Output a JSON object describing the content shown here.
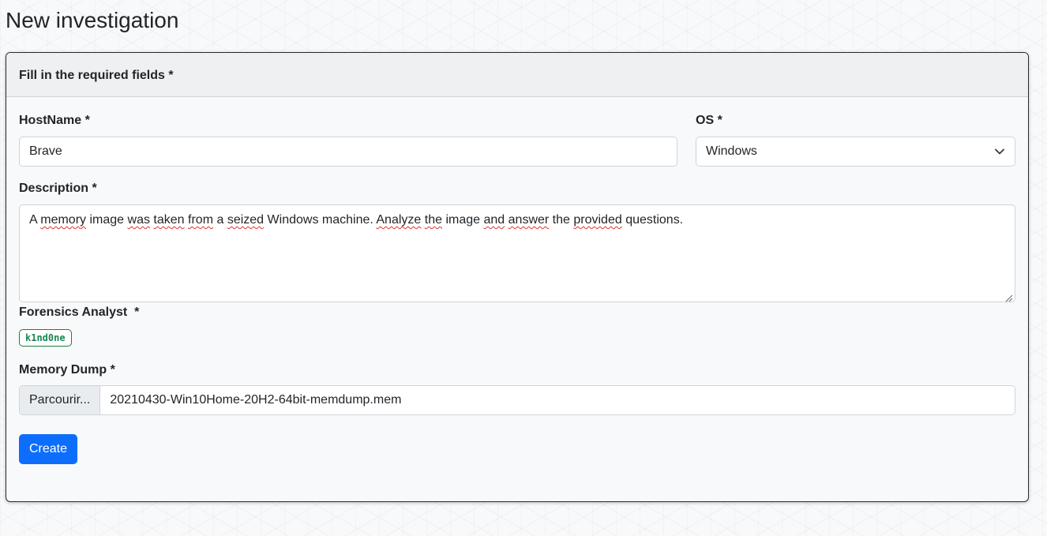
{
  "page": {
    "title": "New investigation"
  },
  "card": {
    "header": "Fill in the required fields *"
  },
  "fields": {
    "hostname": {
      "label": "HostName *",
      "value": "Brave"
    },
    "os": {
      "label": "OS *",
      "selected": "Windows",
      "chevron_icon": "chevron-down-icon"
    },
    "description": {
      "label": "Description *",
      "value": "A memory image was taken from a seized Windows machine. Analyze the image and answer the provided questions."
    },
    "analyst": {
      "label": "Forensics Analyst  *",
      "badge": "k1nd0ne"
    },
    "memory_dump": {
      "label": "Memory Dump *",
      "button_label": "Parcourir...",
      "file_name": "20210430-Win10Home-20H2-64bit-memdump.mem"
    }
  },
  "actions": {
    "create_label": "Create"
  },
  "colors": {
    "primary": "#0d6efd",
    "badge_green": "#198754",
    "header_bg": "#eff0f2"
  }
}
